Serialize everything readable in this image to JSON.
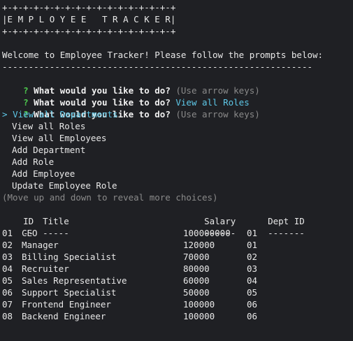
{
  "banner": {
    "top": "+-+-+-+-+-+-+-+-+-+-+-+-+-+-+-+-+",
    "title": "|E M P L O Y E E   T R A C K E R|",
    "bottom": "+-+-+-+-+-+-+-+-+-+-+-+-+-+-+-+-+"
  },
  "welcome": "Welcome to Employee Tracker! Please follow the prompts below:",
  "divider": "-----------------------------------------------------------",
  "prompts": [
    {
      "mark": "?",
      "question": "What would you like to do?",
      "hint": "(Use arrow keys)",
      "answer": ""
    },
    {
      "mark": "?",
      "question": "What would you like to do?",
      "hint": "",
      "answer": "View all Roles"
    },
    {
      "mark": "?",
      "question": "What would you like to do?",
      "hint": "(Use arrow keys)",
      "answer": ""
    }
  ],
  "menu": {
    "pointer": ">",
    "items": [
      "View all Departments",
      "View all Roles",
      "View all Employees",
      "Add Department",
      "Add Role",
      "Add Employee",
      "Update Employee Role"
    ],
    "footer_hint": "(Move up and down to reveal more choices)"
  },
  "table": {
    "headers": [
      "ID",
      "Title",
      "Salary",
      "Dept ID"
    ],
    "underlines": [
      "--",
      "-----",
      "------",
      "-------"
    ],
    "rows": [
      [
        "01",
        "CEO",
        "100000000",
        "01"
      ],
      [
        "02",
        "Manager",
        "120000",
        "01"
      ],
      [
        "03",
        "Billing Specialist",
        "70000",
        "02"
      ],
      [
        "04",
        "Recruiter",
        "80000",
        "03"
      ],
      [
        "05",
        "Sales Representative",
        "60000",
        "04"
      ],
      [
        "06",
        "Support Specialist",
        "50000",
        "05"
      ],
      [
        "07",
        "Frontend Engineer",
        "100000",
        "06"
      ],
      [
        "08",
        "Backend Engineer",
        "100000",
        "06"
      ]
    ]
  },
  "colors": {
    "background": "#1f2024",
    "prompt_mark": "#4ec94e",
    "selection": "#5ec8e8",
    "dim": "#8a8a8a"
  }
}
